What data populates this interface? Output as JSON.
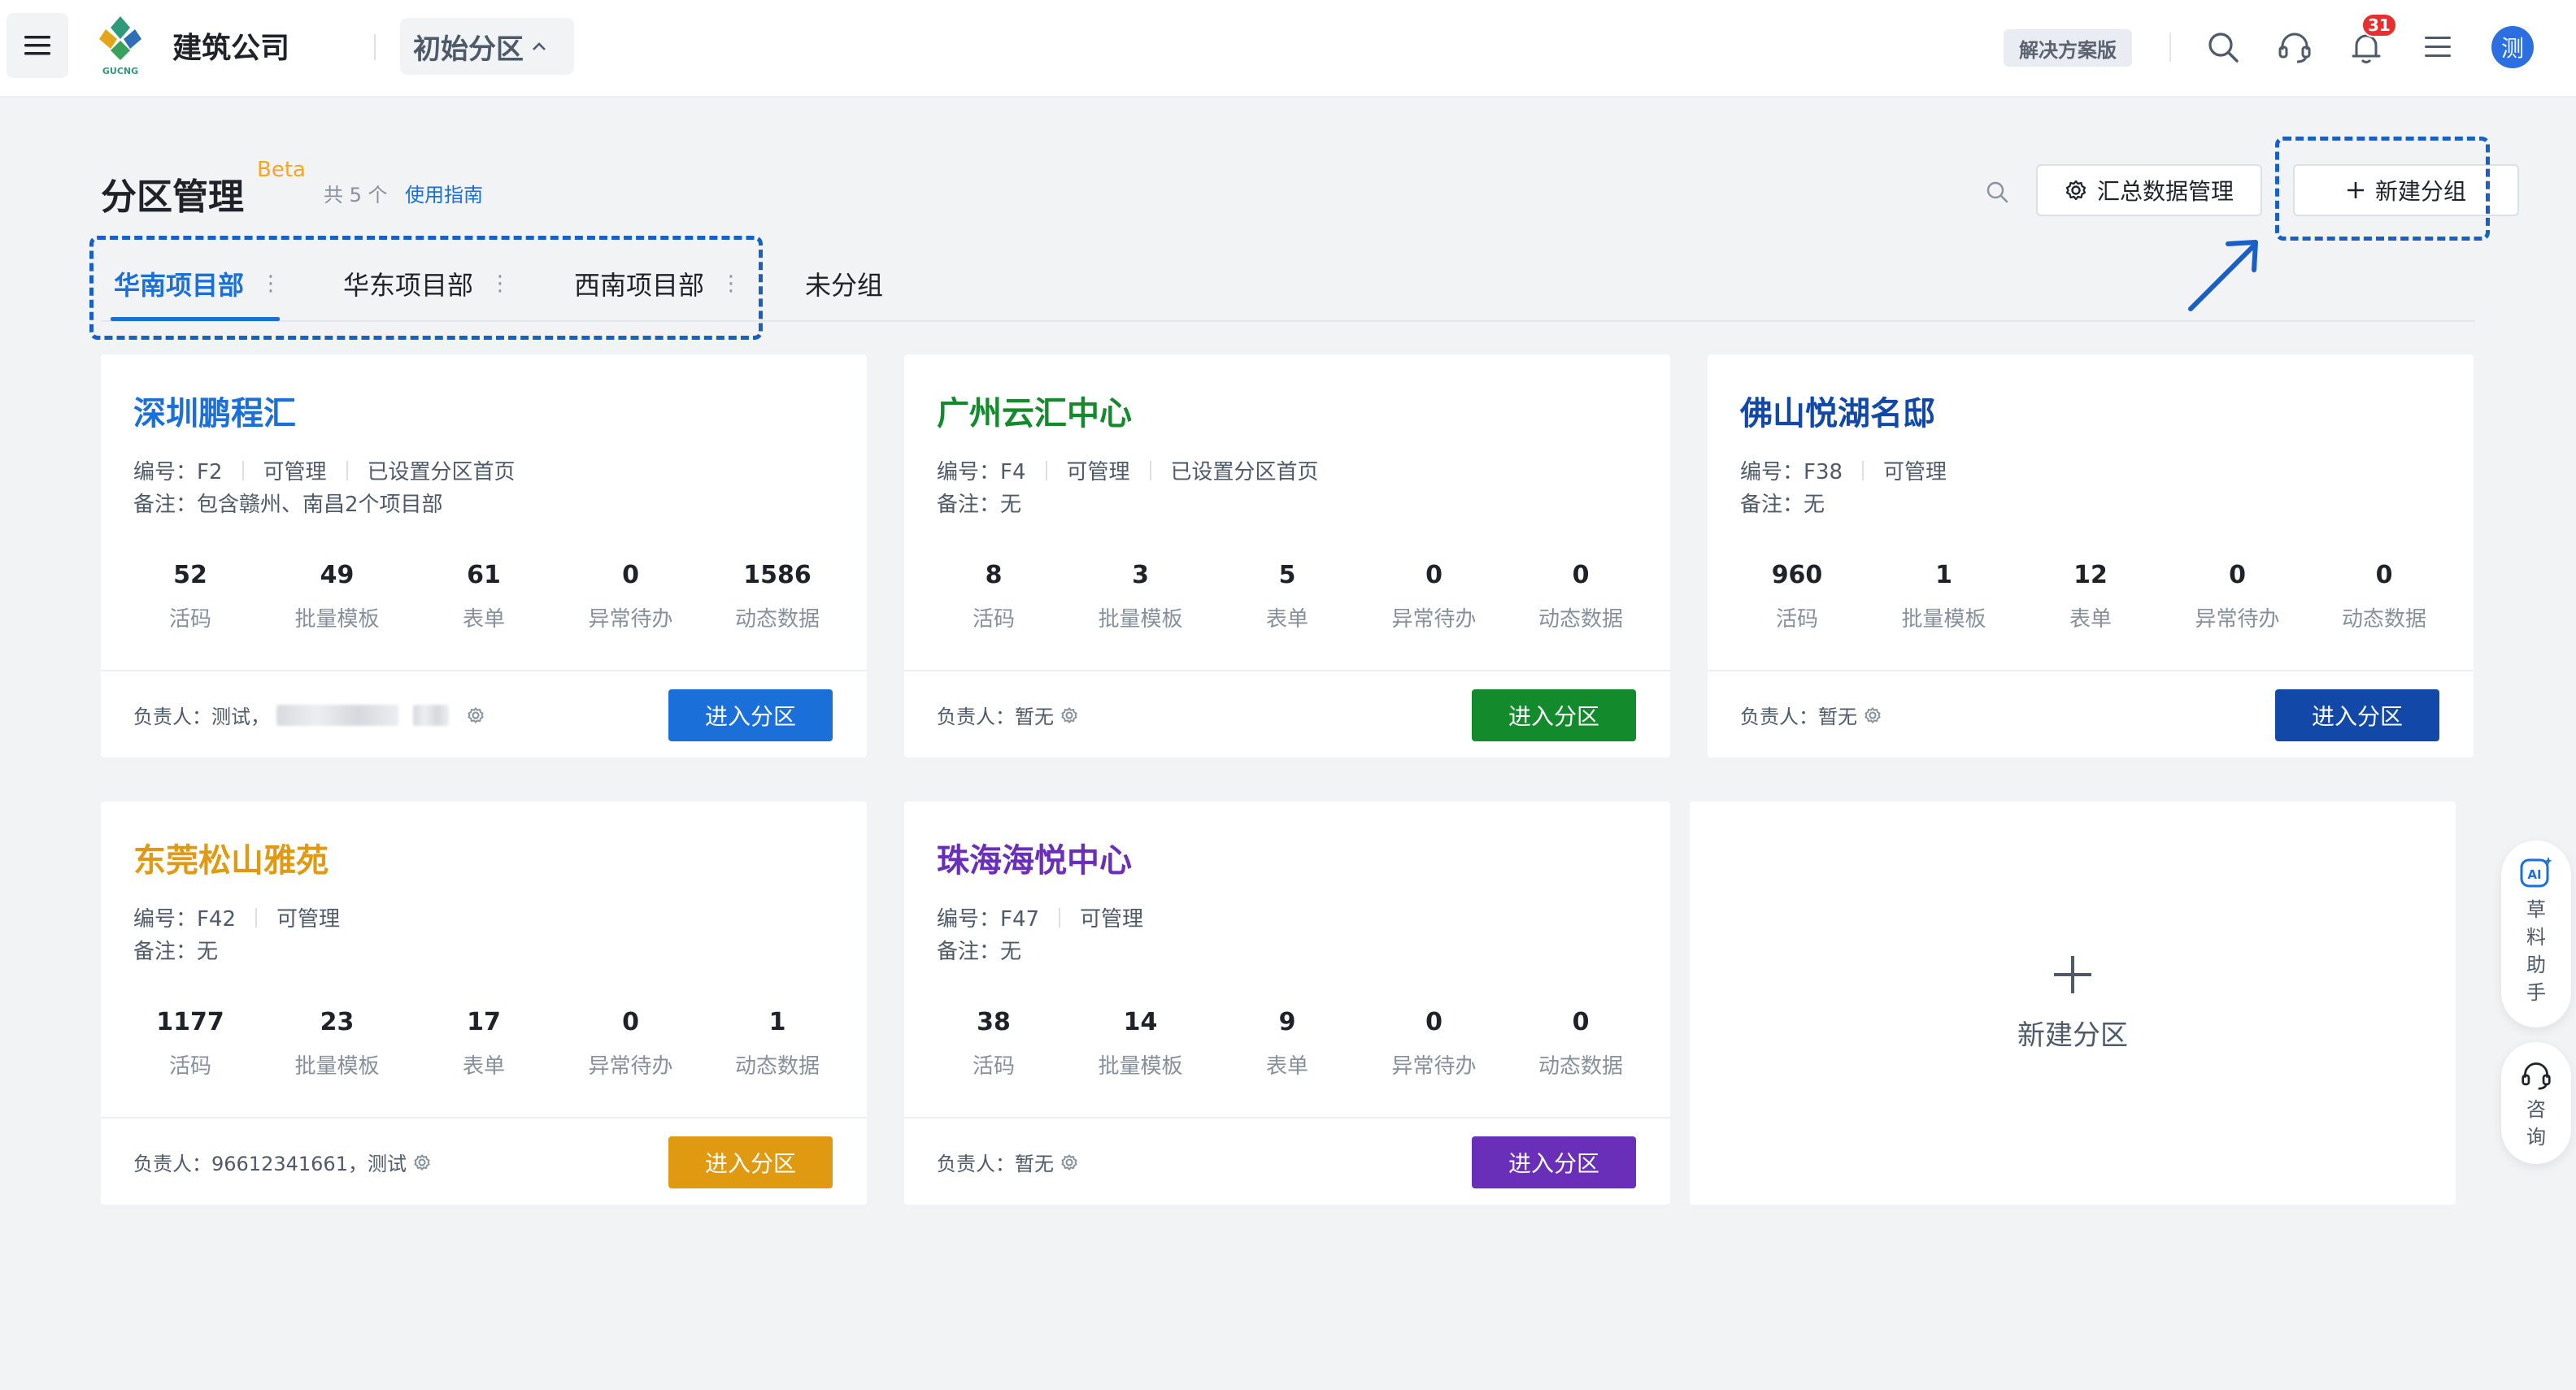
{
  "topbar": {
    "company": "建筑公司",
    "partition": "初始分区",
    "plan": "解决方案版",
    "notification_count": "31",
    "avatar_text": "测"
  },
  "header": {
    "title": "分区管理",
    "beta": "Beta",
    "count": "共 5 个",
    "guide": "使用指南",
    "summary_btn": "汇总数据管理",
    "new_group_btn": "新建分组"
  },
  "tabs": [
    {
      "label": "华南项目部",
      "active": true
    },
    {
      "label": "华东项目部",
      "active": false
    },
    {
      "label": "西南项目部",
      "active": false
    },
    {
      "label": "未分组",
      "active": false
    }
  ],
  "stat_labels": [
    "活码",
    "批量模板",
    "表单",
    "异常待办",
    "动态数据"
  ],
  "cards": [
    {
      "title": "深圳鹏程汇",
      "color": "#1a6fd8",
      "code": "编号：F2",
      "perm": "可管理",
      "home": "已设置分区首页",
      "remark": "备注：包含赣州、南昌2个项目部",
      "stats": [
        "52",
        "49",
        "61",
        "0",
        "1586"
      ],
      "owner": "负责人：测试，",
      "enter": "进入分区"
    },
    {
      "title": "广州云汇中心",
      "color": "#138a2b",
      "code": "编号：F4",
      "perm": "可管理",
      "home": "已设置分区首页",
      "remark": "备注：无",
      "stats": [
        "8",
        "3",
        "5",
        "0",
        "0"
      ],
      "owner": "负责人：暂无",
      "enter": "进入分区"
    },
    {
      "title": "佛山悦湖名邸",
      "color": "#1248a8",
      "code": "编号：F38",
      "perm": "可管理",
      "home": "",
      "remark": "备注：无",
      "stats": [
        "960",
        "1",
        "12",
        "0",
        "0"
      ],
      "owner": "负责人：暂无",
      "enter": "进入分区"
    },
    {
      "title": "东莞松山雅苑",
      "color": "#e09a12",
      "code": "编号：F42",
      "perm": "可管理",
      "home": "",
      "remark": "备注：无",
      "stats": [
        "1177",
        "23",
        "17",
        "0",
        "1"
      ],
      "owner": "负责人：96612341661，测试",
      "enter": "进入分区"
    },
    {
      "title": "珠海海悦中心",
      "color": "#6a2fb8",
      "code": "编号：F47",
      "perm": "可管理",
      "home": "",
      "remark": "备注：无",
      "stats": [
        "38",
        "14",
        "9",
        "0",
        "0"
      ],
      "owner": "负责人：暂无",
      "enter": "进入分区"
    }
  ],
  "new_partition": "新建分区",
  "side": {
    "assistant": "草料助手",
    "consult": "咨询"
  }
}
